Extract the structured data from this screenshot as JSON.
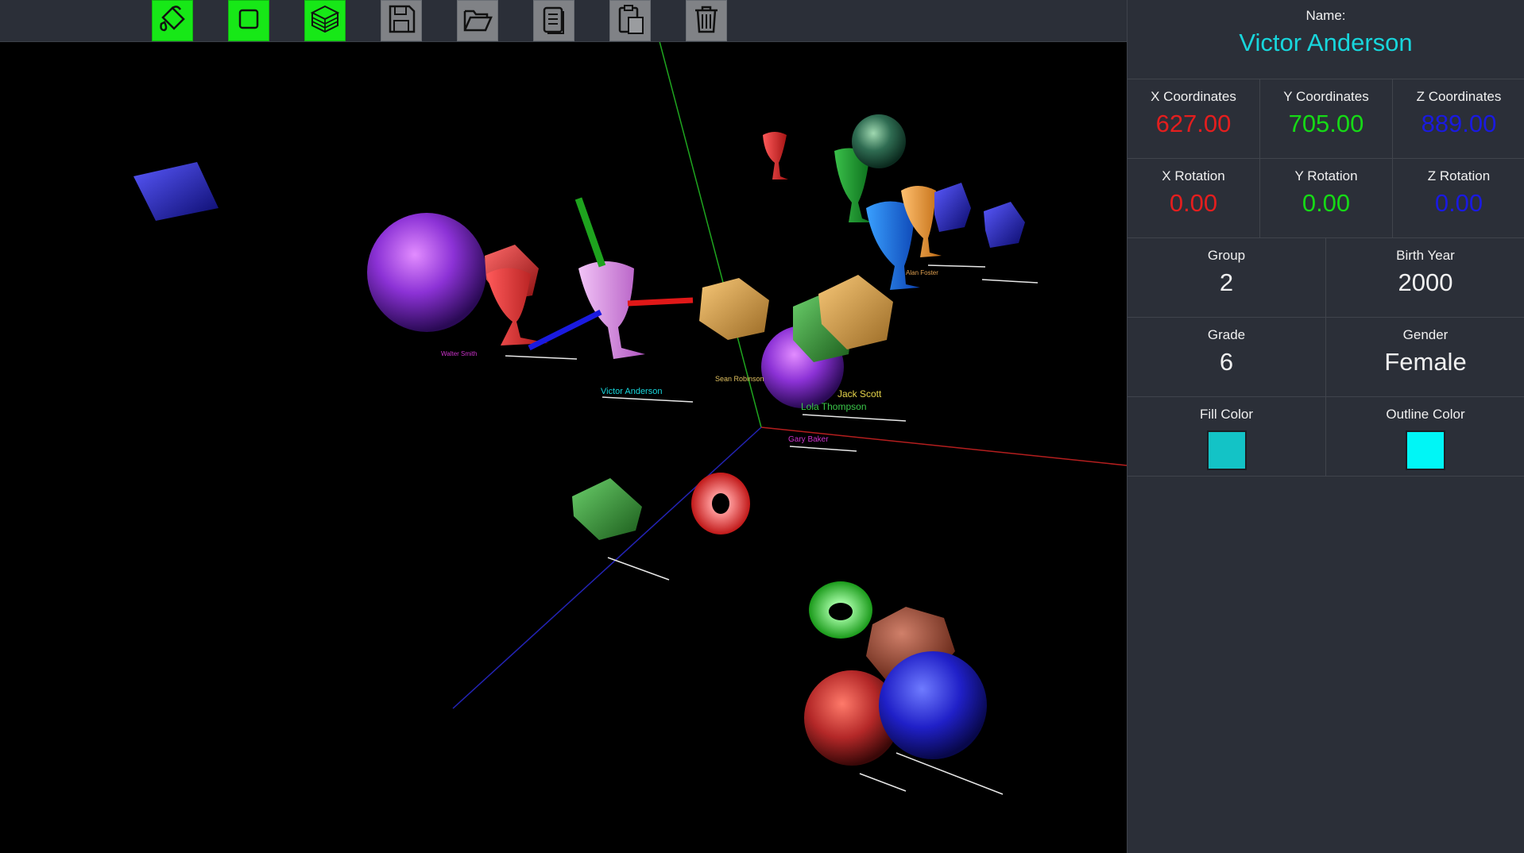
{
  "toolbar": {
    "buttons": [
      {
        "name": "paint-bucket-button",
        "icon": "paint-bucket-icon",
        "active": true
      },
      {
        "name": "square-button",
        "icon": "square-icon",
        "active": true
      },
      {
        "name": "cube-grid-button",
        "icon": "cube-grid-icon",
        "active": true
      },
      {
        "name": "save-button",
        "icon": "floppy-disk-icon",
        "active": false
      },
      {
        "name": "open-button",
        "icon": "folder-open-icon",
        "active": false
      },
      {
        "name": "copy-button",
        "icon": "document-copy-icon",
        "active": false
      },
      {
        "name": "paste-button",
        "icon": "clipboard-icon",
        "active": false
      },
      {
        "name": "delete-button",
        "icon": "trash-icon",
        "active": false
      }
    ]
  },
  "scene": {
    "labels": {
      "victor": "Victor Anderson",
      "sean": "Sean Robinson",
      "jack": "Jack Scott",
      "lola": "Lola Thompson",
      "gary": "Gary Baker",
      "alan": "Alan Foster",
      "walter": "Walter Smith"
    }
  },
  "panel": {
    "name_label": "Name:",
    "name_value": "Victor Anderson",
    "x_coord_label": "X Coordinates",
    "x_coord_value": "627.00",
    "y_coord_label": "Y Coordinates",
    "y_coord_value": "705.00",
    "z_coord_label": "Z Coordinates",
    "z_coord_value": "889.00",
    "x_rot_label": "X Rotation",
    "x_rot_value": "0.00",
    "y_rot_label": "Y Rotation",
    "y_rot_value": "0.00",
    "z_rot_label": "Z Rotation",
    "z_rot_value": "0.00",
    "group_label": "Group",
    "group_value": "2",
    "birth_label": "Birth Year",
    "birth_value": "2000",
    "grade_label": "Grade",
    "grade_value": "6",
    "gender_label": "Gender",
    "gender_value": "Female",
    "fill_label": "Fill Color",
    "outline_label": "Outline Color"
  },
  "colors": {
    "name": "#18d6dc",
    "x": "#e41e1e",
    "y": "#16d916",
    "z": "#1a1ae0",
    "fill": "#13c3c6",
    "outline": "#00f6f6",
    "active_button": "#17e817"
  }
}
